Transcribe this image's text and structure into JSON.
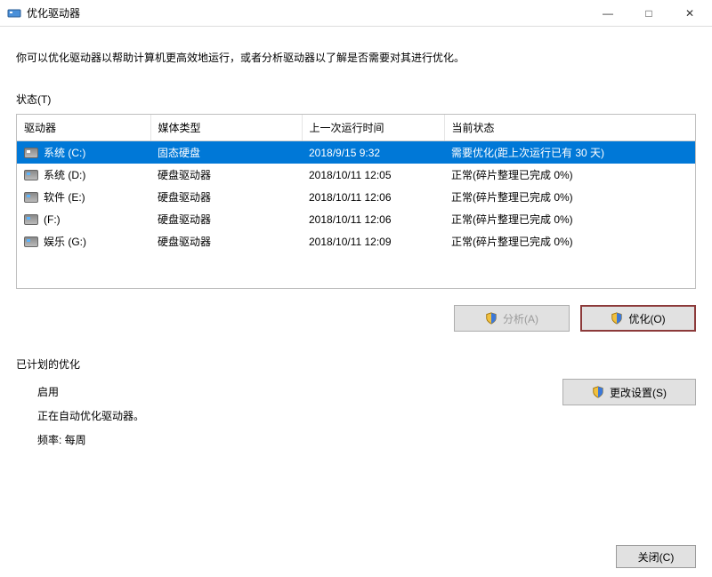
{
  "window": {
    "title": "优化驱动器",
    "minimize": "—",
    "maximize": "□",
    "close": "✕"
  },
  "description": "你可以优化驱动器以帮助计算机更高效地运行，或者分析驱动器以了解是否需要对其进行优化。",
  "status_label": "状态(T)",
  "columns": {
    "drive": "驱动器",
    "media": "媒体类型",
    "last_run": "上一次运行时间",
    "status": "当前状态"
  },
  "drives": [
    {
      "name": "系统 (C:)",
      "media": "固态硬盘",
      "last": "2018/9/15 9:32",
      "status": "需要优化(距上次运行已有 30 天)",
      "selected": true
    },
    {
      "name": "系统 (D:)",
      "media": "硬盘驱动器",
      "last": "2018/10/11 12:05",
      "status": "正常(碎片整理已完成 0%)",
      "selected": false
    },
    {
      "name": "软件 (E:)",
      "media": "硬盘驱动器",
      "last": "2018/10/11 12:06",
      "status": "正常(碎片整理已完成 0%)",
      "selected": false
    },
    {
      "name": "(F:)",
      "media": "硬盘驱动器",
      "last": "2018/10/11 12:06",
      "status": "正常(碎片整理已完成 0%)",
      "selected": false
    },
    {
      "name": "娱乐 (G:)",
      "media": "硬盘驱动器",
      "last": "2018/10/11 12:09",
      "status": "正常(碎片整理已完成 0%)",
      "selected": false
    }
  ],
  "buttons": {
    "analyze": "分析(A)",
    "optimize": "优化(O)",
    "change_settings": "更改设置(S)",
    "close": "关闭(C)"
  },
  "scheduled": {
    "heading": "已计划的优化",
    "enabled_label": "启用",
    "line1": "正在自动优化驱动器。",
    "line2": "频率: 每周"
  }
}
